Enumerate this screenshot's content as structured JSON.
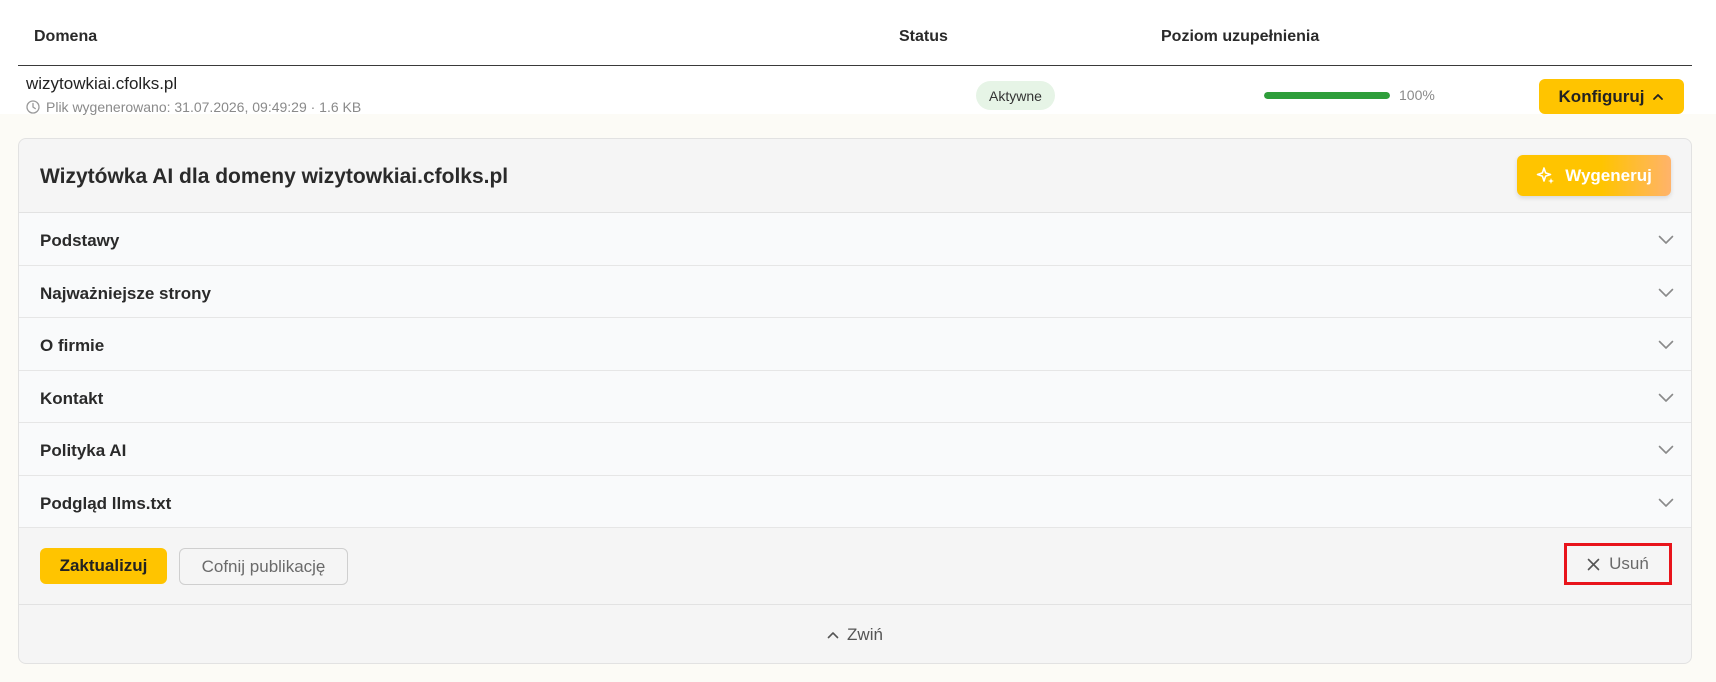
{
  "table": {
    "headers": {
      "domain": "Domena",
      "status": "Status",
      "fill_level": "Poziom uzupełnienia"
    },
    "row": {
      "domain": "wizytowkiai.cfolks.pl",
      "file_info": "Plik wygenerowano: 31.07.2026, 09:49:29 · 1.6 KB",
      "status": "Aktywne",
      "progress": 100,
      "progress_text": "100%",
      "configure_label": "Konfiguruj"
    }
  },
  "panel": {
    "title": "Wizytówka AI dla domeny wizytowkiai.cfolks.pl",
    "generate_label": "Wygeneruj",
    "sections": [
      {
        "label": "Podstawy"
      },
      {
        "label": "Najważniejsze strony"
      },
      {
        "label": "O firmie"
      },
      {
        "label": "Kontakt"
      },
      {
        "label": "Polityka AI"
      },
      {
        "label": "Podgląd llms.txt"
      }
    ],
    "actions": {
      "update_label": "Zaktualizuj",
      "unpublish_label": "Cofnij publikację",
      "delete_label": "Usuń"
    },
    "collapse_label": "Zwiń"
  },
  "colors": {
    "accent": "#ffc400",
    "progress": "#2e9e3a",
    "status_badge_bg": "#e6f4e6",
    "highlight": "#e8141b"
  },
  "icons": {
    "clock": "clock-icon",
    "chevron_up": "chevron-up-icon",
    "sparkle": "sparkle-icon",
    "chevron_down": "chevron-down-icon",
    "close": "close-icon"
  }
}
